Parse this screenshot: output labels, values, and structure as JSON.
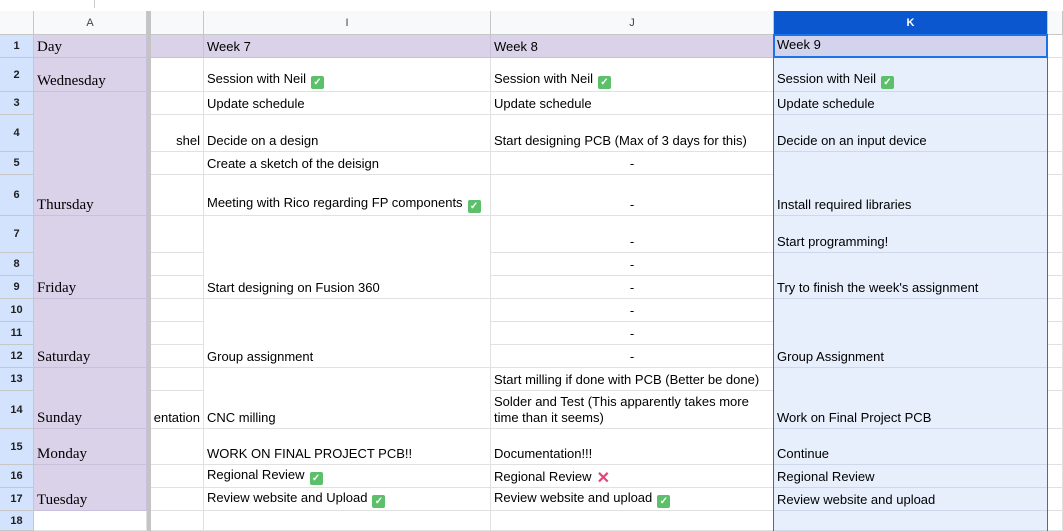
{
  "columns": [
    "A",
    "",
    "I",
    "J",
    "K"
  ],
  "rows": [
    "1",
    "2",
    "3",
    "4",
    "5",
    "6",
    "7",
    "8",
    "9",
    "10",
    "11",
    "12",
    "13",
    "14",
    "15",
    "16",
    "17",
    "18"
  ],
  "selected_column": "K",
  "selected_cell": "K1",
  "colors": {
    "header_purple": "#d9d2e9",
    "selection": "#1a73e8",
    "check": "#5cbf6a",
    "cross": "#e0457a"
  },
  "cells": [
    {
      "col": "A",
      "row": 1,
      "span": 1,
      "text": "Day"
    },
    {
      "col": "A",
      "row": 2,
      "span": 1,
      "text": "Wednesday"
    },
    {
      "col": "A",
      "row": 3,
      "span": 4,
      "text": "Thursday"
    },
    {
      "col": "A",
      "row": 7,
      "span": 3,
      "text": "Friday"
    },
    {
      "col": "A",
      "row": 10,
      "span": 3,
      "text": "Saturday"
    },
    {
      "col": "A",
      "row": 13,
      "span": 2,
      "text": "Sunday"
    },
    {
      "col": "A",
      "row": 15,
      "span": 1,
      "text": "Monday"
    },
    {
      "col": "A",
      "row": 16,
      "span": 2,
      "text": "Tuesday"
    },
    {
      "col": "H",
      "row": 4,
      "span": 1,
      "text": "shel"
    },
    {
      "col": "H",
      "row": 14,
      "span": 1,
      "text": "entation"
    },
    {
      "col": "I",
      "row": 1,
      "span": 1,
      "text": "Week 7"
    },
    {
      "col": "I",
      "row": 2,
      "span": 1,
      "text": "Session with Neil",
      "mark": "check"
    },
    {
      "col": "I",
      "row": 3,
      "span": 1,
      "text": "Update schedule"
    },
    {
      "col": "I",
      "row": 4,
      "span": 1,
      "text": "Decide on a design"
    },
    {
      "col": "I",
      "row": 5,
      "span": 1,
      "text": "Create a sketch of the deisign"
    },
    {
      "col": "I",
      "row": 6,
      "span": 1,
      "text": "Meeting with Rico regarding FP components",
      "mark": "check"
    },
    {
      "col": "I",
      "row": 7,
      "span": 3,
      "text": "Start designing on Fusion 360"
    },
    {
      "col": "I",
      "row": 10,
      "span": 3,
      "text": "Group assignment"
    },
    {
      "col": "I",
      "row": 13,
      "span": 2,
      "text": "CNC milling"
    },
    {
      "col": "I",
      "row": 15,
      "span": 1,
      "text": "WORK ON FINAL PROJECT PCB!!"
    },
    {
      "col": "I",
      "row": 16,
      "span": 1,
      "text": "Regional Review",
      "mark": "check"
    },
    {
      "col": "I",
      "row": 17,
      "span": 1,
      "text": "Review website and Upload",
      "mark": "check"
    },
    {
      "col": "J",
      "row": 1,
      "span": 1,
      "text": "Week 8"
    },
    {
      "col": "J",
      "row": 2,
      "span": 1,
      "text": "Session with Neil",
      "mark": "check"
    },
    {
      "col": "J",
      "row": 3,
      "span": 1,
      "text": "Update schedule"
    },
    {
      "col": "J",
      "row": 4,
      "span": 1,
      "text": "Start designing PCB (Max of 3 days for this)"
    },
    {
      "col": "J",
      "row": 5,
      "span": 1,
      "text": "-",
      "align": "center"
    },
    {
      "col": "J",
      "row": 6,
      "span": 1,
      "text": "-",
      "align": "center"
    },
    {
      "col": "J",
      "row": 7,
      "span": 1,
      "text": "-",
      "align": "center"
    },
    {
      "col": "J",
      "row": 8,
      "span": 1,
      "text": "-",
      "align": "center"
    },
    {
      "col": "J",
      "row": 9,
      "span": 1,
      "text": "-",
      "align": "center"
    },
    {
      "col": "J",
      "row": 10,
      "span": 1,
      "text": "-",
      "align": "center"
    },
    {
      "col": "J",
      "row": 11,
      "span": 1,
      "text": "-",
      "align": "center"
    },
    {
      "col": "J",
      "row": 12,
      "span": 1,
      "text": "-",
      "align": "center"
    },
    {
      "col": "J",
      "row": 13,
      "span": 1,
      "text": "Start milling if done with PCB (Better be done)"
    },
    {
      "col": "J",
      "row": 14,
      "span": 1,
      "text": "Solder and Test (This apparently takes more time than it seems)"
    },
    {
      "col": "J",
      "row": 15,
      "span": 1,
      "text": "Documentation!!!"
    },
    {
      "col": "J",
      "row": 16,
      "span": 1,
      "text": "Regional Review",
      "mark": "cross"
    },
    {
      "col": "J",
      "row": 17,
      "span": 1,
      "text": "Review website and upload",
      "mark": "check"
    },
    {
      "col": "K",
      "row": 1,
      "span": 1,
      "text": "Week 9"
    },
    {
      "col": "K",
      "row": 2,
      "span": 1,
      "text": "Session with Neil",
      "mark": "check"
    },
    {
      "col": "K",
      "row": 3,
      "span": 1,
      "text": "Update schedule"
    },
    {
      "col": "K",
      "row": 4,
      "span": 1,
      "text": "Decide on an input device"
    },
    {
      "col": "K",
      "row": 5,
      "span": 2,
      "text": "Install required libraries"
    },
    {
      "col": "K",
      "row": 7,
      "span": 1,
      "text": "Start programming!"
    },
    {
      "col": "K",
      "row": 8,
      "span": 2,
      "text": "Try to finish the week's assignment"
    },
    {
      "col": "K",
      "row": 10,
      "span": 3,
      "text": "Group Assignment"
    },
    {
      "col": "K",
      "row": 13,
      "span": 2,
      "text": "Work on Final Project PCB"
    },
    {
      "col": "K",
      "row": 15,
      "span": 1,
      "text": "Continue"
    },
    {
      "col": "K",
      "row": 16,
      "span": 1,
      "text": "Regional Review"
    },
    {
      "col": "K",
      "row": 17,
      "span": 1,
      "text": "Review website and upload"
    }
  ]
}
